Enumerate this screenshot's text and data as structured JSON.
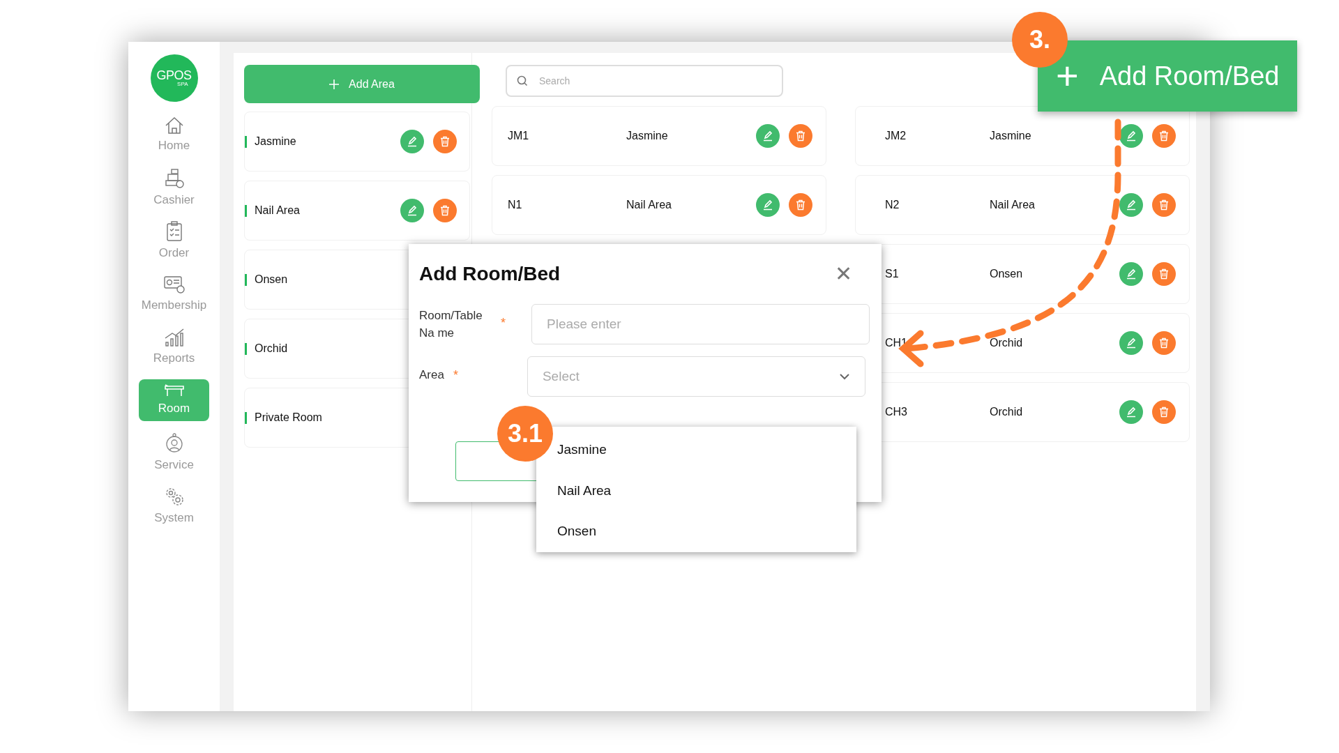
{
  "sidebar": {
    "logo": {
      "name": "GPOS",
      "sub": "SPA"
    },
    "items": [
      {
        "label": "Home",
        "selected": false
      },
      {
        "label": "Cashier",
        "selected": false
      },
      {
        "label": "Order",
        "selected": false
      },
      {
        "label": "Membership",
        "selected": false
      },
      {
        "label": "Reports",
        "selected": false
      },
      {
        "label": "Room",
        "selected": true
      },
      {
        "label": "Service",
        "selected": false
      },
      {
        "label": "System",
        "selected": false
      }
    ]
  },
  "add_area_button": "Add Area",
  "areas": [
    {
      "name": "Jasmine",
      "actions": [
        {
          "kind": "edit"
        },
        {
          "kind": "delete"
        }
      ]
    },
    {
      "name": "Nail Area",
      "actions": [
        {
          "kind": "edit"
        },
        {
          "kind": "delete"
        }
      ]
    },
    {
      "name": "Onsen"
    },
    {
      "name": "Orchid"
    },
    {
      "name": "Private Room"
    }
  ],
  "search": {
    "placeholder": "Search"
  },
  "room_columns": [
    [
      {
        "code": "JM1",
        "area": "Jasmine",
        "actions": [
          {
            "kind": "edit"
          },
          {
            "kind": "delete"
          }
        ]
      },
      {
        "code": "N1",
        "area": "Nail Area",
        "actions": [
          {
            "kind": "edit"
          },
          {
            "kind": "delete"
          }
        ]
      }
    ],
    [
      {
        "code": "JM2",
        "area": "Jasmine",
        "actions": [
          {
            "kind": "edit"
          },
          {
            "kind": "delete"
          }
        ]
      },
      {
        "code": "N2",
        "area": "Nail Area",
        "actions": [
          {
            "kind": "edit"
          },
          {
            "kind": "delete"
          }
        ]
      },
      {
        "code": "S1",
        "area": "Onsen",
        "actions": [
          {
            "kind": "edit"
          },
          {
            "kind": "delete"
          }
        ]
      },
      {
        "code": "CH1",
        "area": "Orchid",
        "actions": [
          {
            "kind": "edit"
          },
          {
            "kind": "delete"
          }
        ]
      },
      {
        "code": "CH3",
        "area": "Orchid",
        "actions": [
          {
            "kind": "edit"
          },
          {
            "kind": "delete"
          }
        ]
      }
    ]
  ],
  "callout_button": {
    "icon": "+",
    "label": "Add Room/Bed"
  },
  "step_badges": [
    "3.",
    "3.1"
  ],
  "modal": {
    "title": "Add Room/Bed",
    "close": "✕",
    "fields": [
      {
        "label": "Room/Table Na me",
        "required": "*",
        "kind": "input",
        "placeholder": "Please enter"
      },
      {
        "label": "Area",
        "required": "*",
        "kind": "select",
        "placeholder": "Select"
      }
    ]
  },
  "dropdown": {
    "options": [
      "Jasmine",
      "Nail Area",
      "Onsen"
    ]
  }
}
